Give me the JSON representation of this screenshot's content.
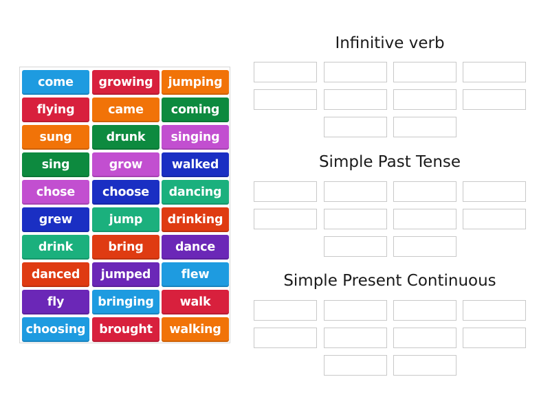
{
  "tiles": [
    {
      "label": "come",
      "color": "#1e9be0"
    },
    {
      "label": "growing",
      "color": "#d8203d"
    },
    {
      "label": "jumping",
      "color": "#f17308"
    },
    {
      "label": "flying",
      "color": "#d8203d"
    },
    {
      "label": "came",
      "color": "#f17308"
    },
    {
      "label": "coming",
      "color": "#0d8a3f"
    },
    {
      "label": "sung",
      "color": "#f17308"
    },
    {
      "label": "drunk",
      "color": "#0d8a3f"
    },
    {
      "label": "singing",
      "color": "#c24fd0"
    },
    {
      "label": "sing",
      "color": "#0d8a3f"
    },
    {
      "label": "grow",
      "color": "#c24fd0"
    },
    {
      "label": "walked",
      "color": "#1a2fc3"
    },
    {
      "label": "chose",
      "color": "#c24fd0"
    },
    {
      "label": "choose",
      "color": "#1a2fc3"
    },
    {
      "label": "dancing",
      "color": "#1bb07d"
    },
    {
      "label": "grew",
      "color": "#1a2fc3"
    },
    {
      "label": "jump",
      "color": "#1bb07d"
    },
    {
      "label": "drinking",
      "color": "#df3b12"
    },
    {
      "label": "drink",
      "color": "#1bb07d"
    },
    {
      "label": "bring",
      "color": "#df3b12"
    },
    {
      "label": "dance",
      "color": "#6b27b7"
    },
    {
      "label": "danced",
      "color": "#df3b12"
    },
    {
      "label": "jumped",
      "color": "#6b27b7"
    },
    {
      "label": "flew",
      "color": "#1e9be0"
    },
    {
      "label": "fly",
      "color": "#6b27b7"
    },
    {
      "label": "bringing",
      "color": "#1e9be0"
    },
    {
      "label": "walk",
      "color": "#d8203d"
    },
    {
      "label": "choosing",
      "color": "#1e9be0"
    },
    {
      "label": "brought",
      "color": "#d8203d"
    },
    {
      "label": "walking",
      "color": "#f17308"
    }
  ],
  "groups": [
    {
      "title": "Infinitive verb",
      "slots": 10
    },
    {
      "title": "Simple Past Tense",
      "slots": 10
    },
    {
      "title": "Simple Present Continuous",
      "slots": 10
    }
  ]
}
